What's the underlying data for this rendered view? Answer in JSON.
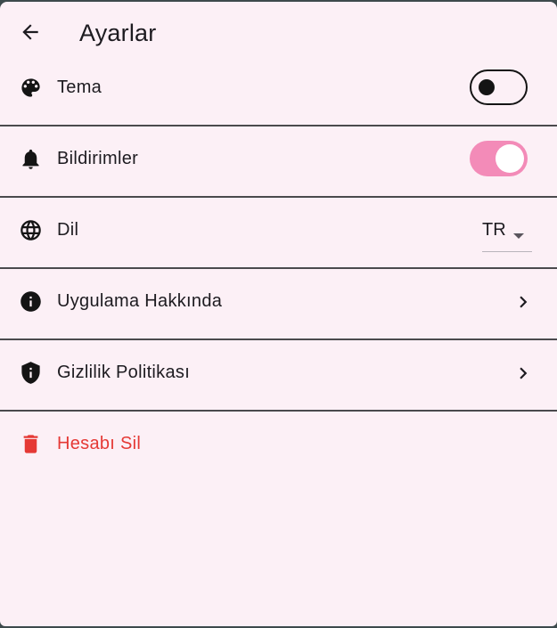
{
  "app_bar": {
    "title": "Ayarlar",
    "back_icon": "arrow-back-icon"
  },
  "settings": {
    "theme": {
      "label": "Tema",
      "icon": "palette-icon",
      "control": "switch",
      "enabled": false
    },
    "notifications": {
      "label": "Bildirimler",
      "icon": "bell-icon",
      "control": "switch",
      "enabled": true
    },
    "language": {
      "label": "Dil",
      "icon": "globe-icon",
      "control": "dropdown",
      "value": "TR"
    },
    "about": {
      "label": "Uygulama Hakkında",
      "icon": "info-icon",
      "control": "chevron"
    },
    "privacy": {
      "label": "Gizlilik Politikası",
      "icon": "shield-icon",
      "control": "chevron"
    },
    "delete_account": {
      "label": "Hesabı Sil",
      "icon": "trash-icon"
    }
  },
  "colors": {
    "background": "#fcf0f6",
    "switch_on": "#f38bb8",
    "danger": "#e53935",
    "text": "#1d1b20",
    "divider": "#4a4a4d"
  }
}
